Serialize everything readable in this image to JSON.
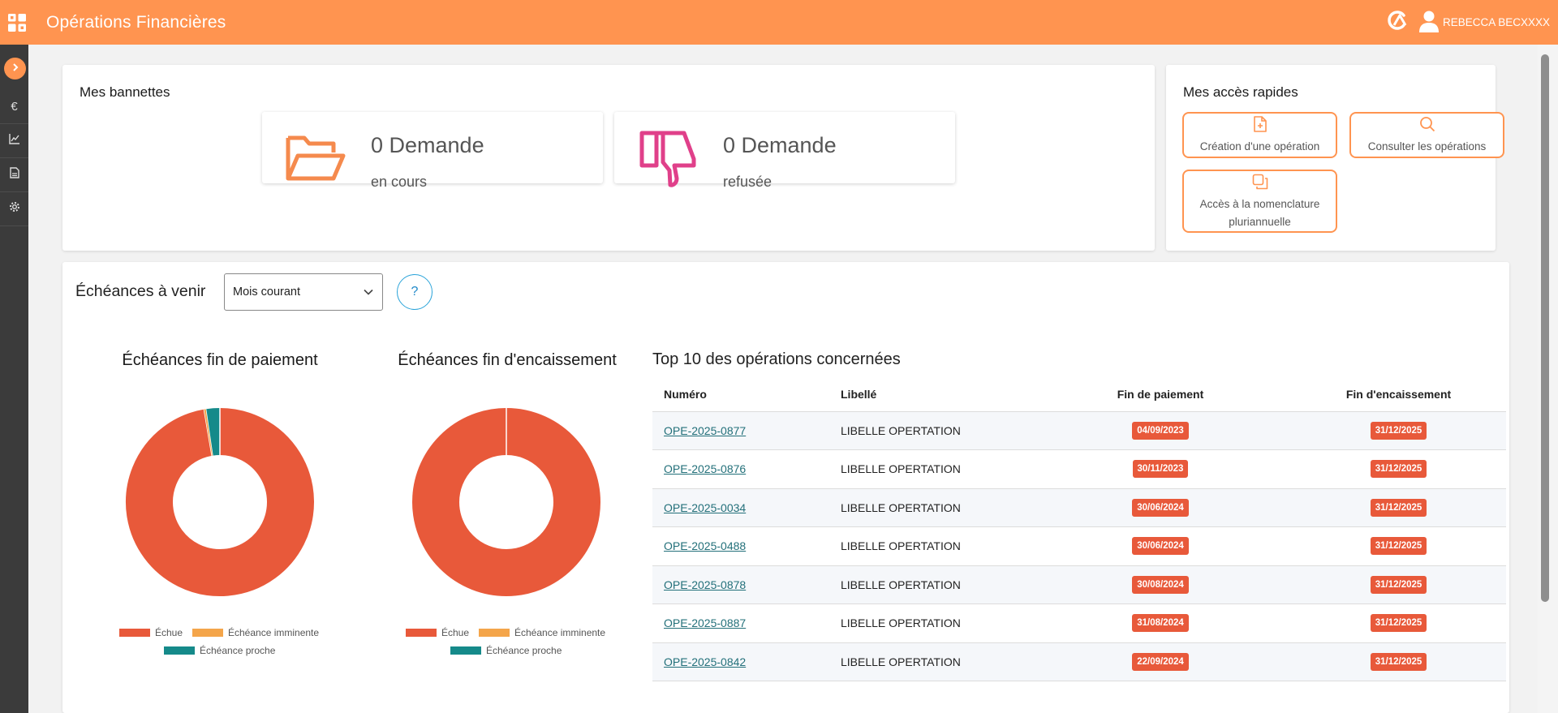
{
  "header": {
    "title": "Opérations Financières",
    "user": "REBECCA BECXXXX",
    "accent_color": "#ff9450"
  },
  "sidebar": {
    "items": [
      {
        "icon": "chevron-right-icon"
      },
      {
        "icon": "euro-icon"
      },
      {
        "icon": "line-chart-icon"
      },
      {
        "icon": "document-icon"
      },
      {
        "icon": "gear-icon"
      }
    ]
  },
  "bannettes": {
    "title": "Mes bannettes",
    "items": [
      {
        "count": "0 Demande",
        "label": "en cours",
        "icon": "open-folder-icon",
        "color": "#f58a4d"
      },
      {
        "count": "0 Demande",
        "label": "refusée",
        "icon": "thumbs-down-icon",
        "color": "#e0408a"
      }
    ]
  },
  "quick_access": {
    "title": "Mes accès rapides",
    "buttons": [
      {
        "label": "Création d'une opération",
        "icon": "file-plus-icon"
      },
      {
        "label": "Consulter les opérations",
        "icon": "search-icon"
      },
      {
        "label_line1": "Accès à la nomenclature",
        "label_line2": "pluriannuelle",
        "icon": "copy-icon"
      }
    ]
  },
  "echeances": {
    "title": "Échéances à venir",
    "filter_value": "Mois courant",
    "help_label": "?"
  },
  "chart_data": [
    {
      "type": "pie",
      "title": "Échéances fin de paiement",
      "categories": [
        "Échue",
        "Échéance imminente",
        "Échéance proche"
      ],
      "values": [
        97.3,
        0.4,
        2.3
      ],
      "colors": [
        "#e8593a",
        "#f4a54a",
        "#158a8a"
      ],
      "legend": "bottom"
    },
    {
      "type": "pie",
      "title": "Échéances fin d'encaissement",
      "categories": [
        "Échue",
        "Échéance imminente",
        "Échéance proche"
      ],
      "values": [
        100,
        0,
        0
      ],
      "colors": [
        "#e8593a",
        "#f4a54a",
        "#158a8a"
      ],
      "legend": "bottom"
    }
  ],
  "top10": {
    "title": "Top 10 des opérations concernées",
    "columns": [
      "Numéro",
      "Libellé",
      "Fin de paiement",
      "Fin d'encaissement"
    ],
    "rows": [
      {
        "numero": "OPE-2025-0877",
        "libelle": "LIBELLE OPERTATION",
        "fin_paiement": "04/09/2023",
        "fin_encaissement": "31/12/2025"
      },
      {
        "numero": "OPE-2025-0876",
        "libelle": "LIBELLE OPERTATION",
        "fin_paiement": "30/11/2023",
        "fin_encaissement": "31/12/2025"
      },
      {
        "numero": "OPE-2025-0034",
        "libelle": "LIBELLE OPERTATION",
        "fin_paiement": "30/06/2024",
        "fin_encaissement": "31/12/2025"
      },
      {
        "numero": "OPE-2025-0488",
        "libelle": "LIBELLE OPERTATION",
        "fin_paiement": "30/06/2024",
        "fin_encaissement": "31/12/2025"
      },
      {
        "numero": "OPE-2025-0878",
        "libelle": "LIBELLE OPERTATION",
        "fin_paiement": "30/08/2024",
        "fin_encaissement": "31/12/2025"
      },
      {
        "numero": "OPE-2025-0887",
        "libelle": "LIBELLE OPERTATION",
        "fin_paiement": "31/08/2024",
        "fin_encaissement": "31/12/2025"
      },
      {
        "numero": "OPE-2025-0842",
        "libelle": "LIBELLE OPERTATION",
        "fin_paiement": "22/09/2024",
        "fin_encaissement": "31/12/2025"
      }
    ],
    "badge_color": "#e8593a"
  }
}
